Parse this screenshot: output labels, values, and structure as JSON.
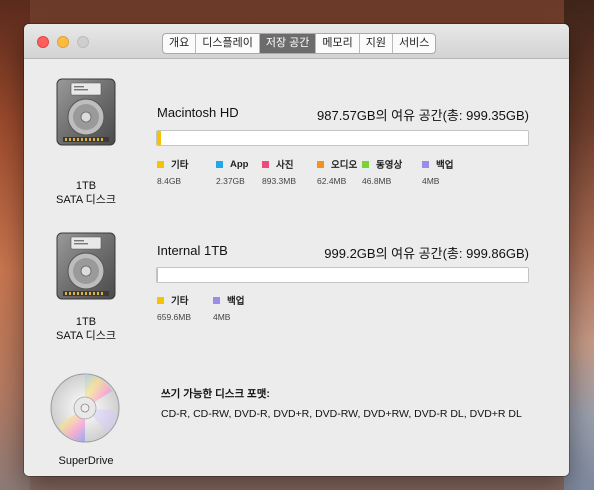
{
  "tabs": [
    {
      "label": "개요",
      "active": false
    },
    {
      "label": "디스플레이",
      "active": false
    },
    {
      "label": "저장 공간",
      "active": true
    },
    {
      "label": "메모리",
      "active": false
    },
    {
      "label": "지원",
      "active": false
    },
    {
      "label": "서비스",
      "active": false
    }
  ],
  "volumes": [
    {
      "caption_line1": "1TB",
      "caption_line2": "SATA 디스크",
      "name": "Macintosh HD",
      "free_text": "987.57GB의 여유 공간(총: 999.35GB)",
      "used_fraction": 0.012,
      "legend": [
        {
          "label": "기타",
          "size": "8.4GB",
          "color": "#f5c400"
        },
        {
          "label": "App",
          "size": "2.37GB",
          "color": "#20a9e6"
        },
        {
          "label": "사진",
          "size": "893.3MB",
          "color": "#ee4a7c"
        },
        {
          "label": "오디오",
          "size": "62.4MB",
          "color": "#f5921e"
        },
        {
          "label": "동영상",
          "size": "46.8MB",
          "color": "#7bd233"
        },
        {
          "label": "백업",
          "size": "4MB",
          "color": "#9b8ee8"
        }
      ]
    },
    {
      "caption_line1": "1TB",
      "caption_line2": "SATA 디스크",
      "name": "Internal 1TB",
      "free_text": "999.2GB의 여유 공간(총: 999.86GB)",
      "used_fraction": 0.001,
      "legend": [
        {
          "label": "기타",
          "size": "659.6MB",
          "color": "#f5c400"
        },
        {
          "label": "백업",
          "size": "4MB",
          "color": "#9b8ee8"
        }
      ]
    }
  ],
  "superdrive": {
    "caption": "SuperDrive",
    "formats_title": "쓰기 가능한 디스크 포맷:",
    "formats": "CD-R, CD-RW, DVD-R, DVD+R, DVD-RW, DVD+RW, DVD-R DL, DVD+R DL"
  }
}
